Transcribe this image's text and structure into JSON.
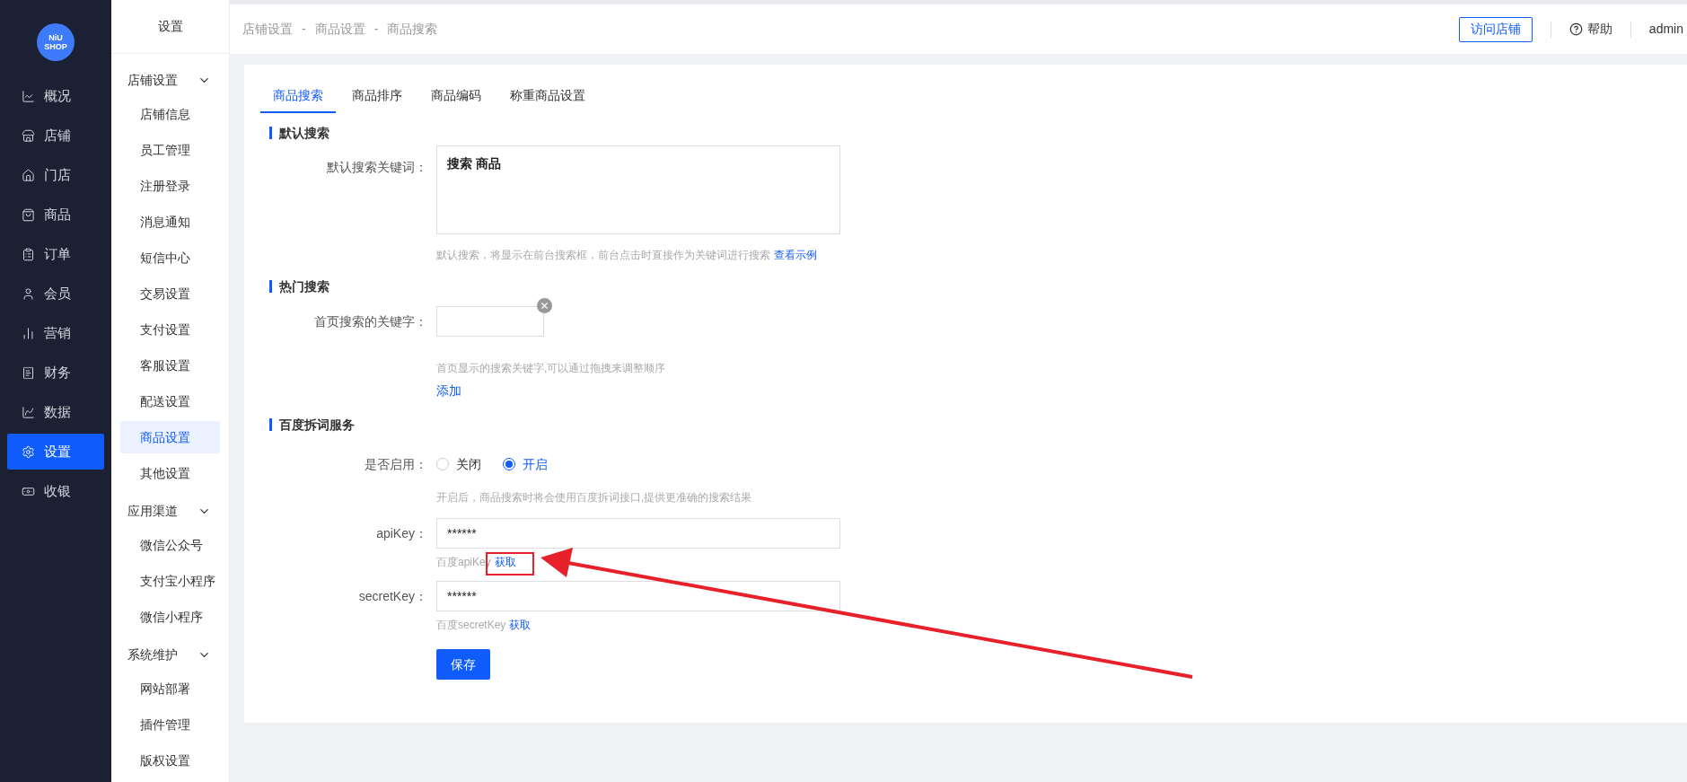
{
  "logo": {
    "line1": "NiU",
    "line2": "SHOP"
  },
  "main_nav": [
    {
      "label": "概况",
      "selected": false
    },
    {
      "label": "店铺",
      "selected": false
    },
    {
      "label": "门店",
      "selected": false
    },
    {
      "label": "商品",
      "selected": false
    },
    {
      "label": "订单",
      "selected": false
    },
    {
      "label": "会员",
      "selected": false
    },
    {
      "label": "营销",
      "selected": false
    },
    {
      "label": "财务",
      "selected": false
    },
    {
      "label": "数据",
      "selected": false
    },
    {
      "label": "设置",
      "selected": true
    },
    {
      "label": "收银",
      "selected": false
    }
  ],
  "sub_nav": {
    "title": "设置",
    "groups": [
      {
        "label": "店铺设置",
        "expanded": true,
        "children": [
          {
            "label": "店铺信息",
            "selected": false
          },
          {
            "label": "员工管理",
            "selected": false
          },
          {
            "label": "注册登录",
            "selected": false
          },
          {
            "label": "消息通知",
            "selected": false
          },
          {
            "label": "短信中心",
            "selected": false
          },
          {
            "label": "交易设置",
            "selected": false
          },
          {
            "label": "支付设置",
            "selected": false
          },
          {
            "label": "客服设置",
            "selected": false
          },
          {
            "label": "配送设置",
            "selected": false
          },
          {
            "label": "商品设置",
            "selected": true
          },
          {
            "label": "其他设置",
            "selected": false
          }
        ]
      },
      {
        "label": "应用渠道",
        "expanded": true,
        "children": [
          {
            "label": "微信公众号",
            "selected": false
          },
          {
            "label": "支付宝小程序",
            "selected": false
          },
          {
            "label": "微信小程序",
            "selected": false
          }
        ]
      },
      {
        "label": "系统维护",
        "expanded": true,
        "children": [
          {
            "label": "网站部署",
            "selected": false
          },
          {
            "label": "插件管理",
            "selected": false
          },
          {
            "label": "版权设置",
            "selected": false
          }
        ]
      }
    ]
  },
  "breadcrumb": [
    "店铺设置",
    "商品设置",
    "商品搜索"
  ],
  "breadcrumb_separator": "-",
  "header": {
    "visit_button": "访问店铺",
    "help": "帮助",
    "user": "admin"
  },
  "tabs": [
    {
      "label": "商品搜索",
      "selected": true
    },
    {
      "label": "商品排序",
      "selected": false
    },
    {
      "label": "商品编码",
      "selected": false
    },
    {
      "label": "称重商品设置",
      "selected": false
    }
  ],
  "default_search": {
    "title": "默认搜索",
    "label": "默认搜索关键词：",
    "value": "搜索 商品",
    "hint": "默认搜索，将显示在前台搜索框，前台点击时直接作为关键词进行搜索",
    "hint_link": "查看示例"
  },
  "hot_search": {
    "title": "热门搜索",
    "label": "首页搜索的关键字：",
    "hint": "首页显示的搜索关键字,可以通过拖拽来调整顺序",
    "add_link": "添加"
  },
  "baidu": {
    "title": "百度拆词服务",
    "enable_label": "是否启用：",
    "options": [
      {
        "label": "关闭",
        "selected": false
      },
      {
        "label": "开启",
        "selected": true
      }
    ],
    "enable_hint": "开启后，商品搜索时将会使用百度拆词接口,提供更准确的搜索结果",
    "fields": [
      {
        "label": "apiKey：",
        "value": "******",
        "hint": "百度apiKey",
        "link": "获取"
      },
      {
        "label": "secretKey：",
        "value": "******",
        "hint": "百度secretKey",
        "link": "获取"
      }
    ]
  },
  "save_button": "保存"
}
